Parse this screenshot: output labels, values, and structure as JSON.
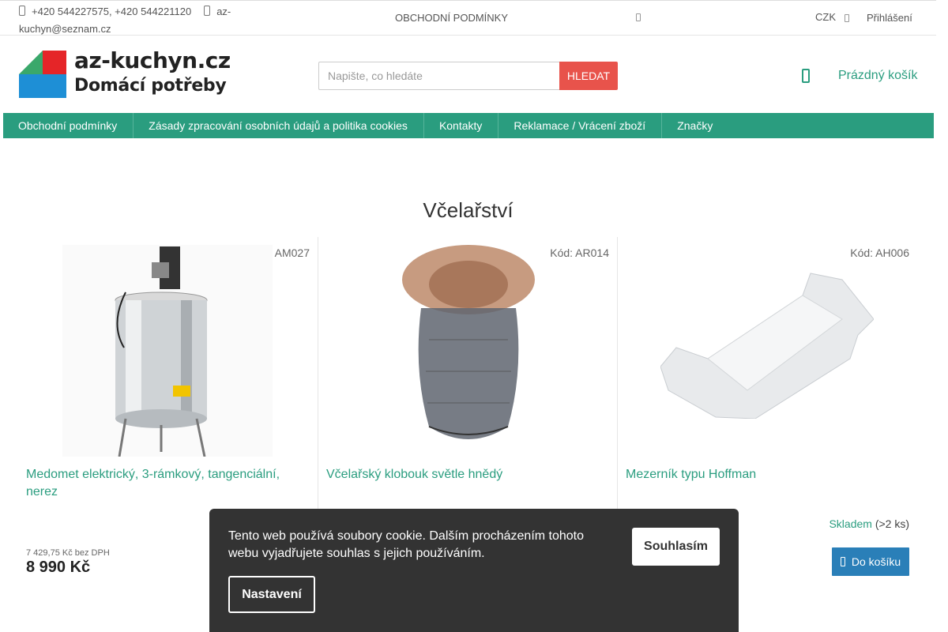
{
  "topbar": {
    "phones": "+420 544227575, +420 544221120",
    "email": "az-kuchyn@seznam.cz",
    "terms_link": "OBCHODNÍ PODMÍNKY",
    "currency": "CZK",
    "login": "Přihlášení"
  },
  "logo": {
    "line1": "az-kuchyn.cz",
    "line2": "Domácí potřeby",
    "colors": {
      "red": "#e52528",
      "green": "#3aa86b",
      "blue": "#1e8fd6",
      "gray": "#9a9a9a"
    }
  },
  "search": {
    "placeholder": "Napište, co hledáte",
    "button": "HLEDAT"
  },
  "cart": {
    "label": "Prázdný košík"
  },
  "nav": {
    "items": [
      "Obchodní podmínky",
      "Zásady zpracování osobních údajů a politika cookies",
      "Kontakty",
      "Reklamace / Vrácení zboží",
      "Značky"
    ]
  },
  "page": {
    "title": "Včelařství"
  },
  "products": [
    {
      "code": "Kód: AM027",
      "name": "Medomet elektrický, 3-rámkový, tangenciální, nerez",
      "price_net": "7 429,75 Kč bez DPH",
      "price": "8 990 Kč"
    },
    {
      "code": "Kód: AR014",
      "name": "Včelařský klobouk světle hnědý"
    },
    {
      "code": "Kód: AH006",
      "name": "Mezerník typu Hoffman",
      "stock_status": "Skladem",
      "stock_qty": "(>2 ks)",
      "buy_label": "Do košíku"
    }
  ],
  "cookie": {
    "text": "Tento web používá soubory cookie. Dalším procházením tohoto webu vyjadřujete souhlas s jejich používáním.",
    "agree": "Souhlasím",
    "settings": "Nastavení"
  },
  "colors": {
    "accent": "#2a9d7f",
    "search_button": "#e8534b",
    "buy_button": "#2a7fb8",
    "cookie_bg": "#333333"
  }
}
